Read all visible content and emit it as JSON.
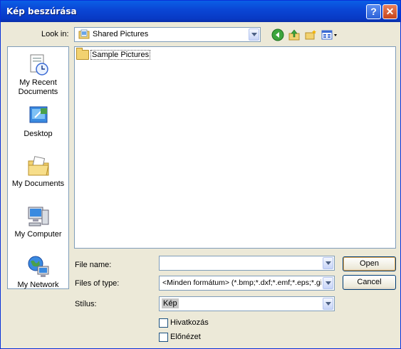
{
  "window": {
    "title": "Kép beszúrása"
  },
  "titlebar": {
    "help_label": "?",
    "close_label": "✕"
  },
  "look_in": {
    "label": "Look in:",
    "value": "Shared Pictures"
  },
  "toolbar": {
    "icons": [
      "back-icon",
      "up-folder-icon",
      "new-folder-icon",
      "views-menu-icon"
    ]
  },
  "places": [
    {
      "label1": "My Recent",
      "label2": "Documents",
      "icon": "recent-documents-icon"
    },
    {
      "label1": "Desktop",
      "label2": "",
      "icon": "desktop-icon"
    },
    {
      "label1": "My Documents",
      "label2": "",
      "icon": "my-documents-icon"
    },
    {
      "label1": "My Computer",
      "label2": "",
      "icon": "my-computer-icon"
    },
    {
      "label1": "My Network",
      "label2": "",
      "icon": "my-network-icon"
    }
  ],
  "files": [
    {
      "name": "Sample Pictures",
      "type": "folder"
    }
  ],
  "file_name": {
    "label": "File name:",
    "value": ""
  },
  "files_of_type": {
    "label": "Files of type:",
    "value": "<Minden formátum> (*.bmp;*.dxf;*.emf;*.eps;*.gif"
  },
  "stilus": {
    "label": "Stílus:",
    "value": "Kép"
  },
  "checkboxes": [
    {
      "label": "Hivatkozás",
      "checked": false
    },
    {
      "label": "Előnézet",
      "checked": false
    }
  ],
  "buttons": {
    "open": "Open",
    "cancel": "Cancel"
  }
}
